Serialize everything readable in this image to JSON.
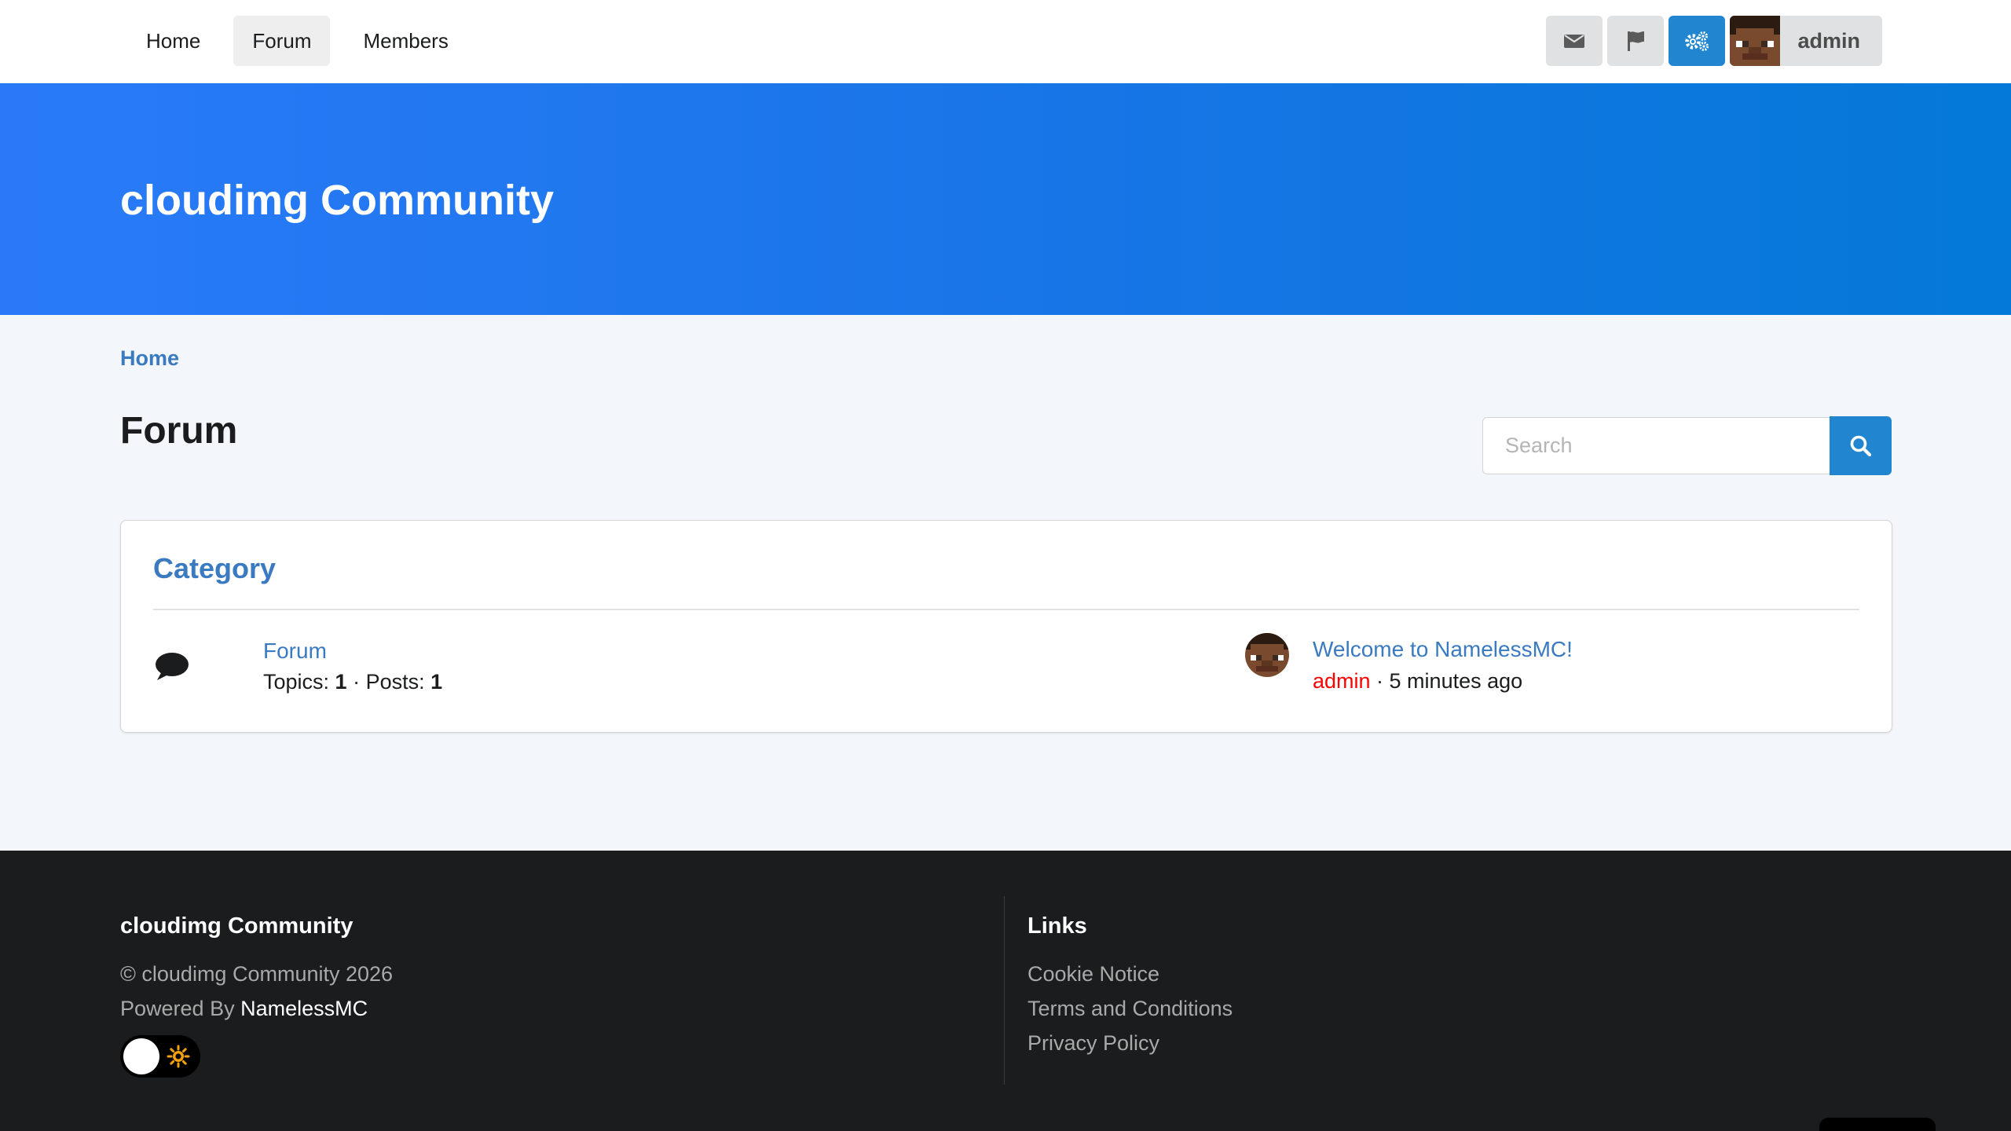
{
  "nav": {
    "links": [
      "Home",
      "Forum",
      "Members"
    ],
    "icons": [
      "envelope-icon",
      "flag-icon",
      "cogs-icon"
    ],
    "username": "admin"
  },
  "hero": {
    "title": "cloudimg Community"
  },
  "breadcrumb": {
    "home": "Home"
  },
  "page": {
    "title": "Forum"
  },
  "search": {
    "placeholder": "Search"
  },
  "category": {
    "title": "Category",
    "forum": {
      "name": "Forum",
      "topics_label": "Topics: ",
      "topics": "1",
      "posts_label": " · Posts: ",
      "posts": "1"
    },
    "latest": {
      "title": "Welcome to NamelessMC!",
      "author": "admin",
      "time": " · 5 minutes ago"
    }
  },
  "footer": {
    "site_name": "cloudimg Community",
    "copyright": "© cloudimg Community 2026",
    "powered_label": "Powered By ",
    "powered_brand": "NamelessMC",
    "links_heading": "Links",
    "links": [
      "Cookie Notice",
      "Terms and Conditions",
      "Privacy Policy"
    ]
  },
  "colors": {
    "accent": "#2185d0",
    "link": "#3a7ac0",
    "hero_start": "#2a7af8",
    "hero_end": "#0479d8",
    "footer_bg": "#1b1c1d",
    "author": "#ff0000"
  }
}
